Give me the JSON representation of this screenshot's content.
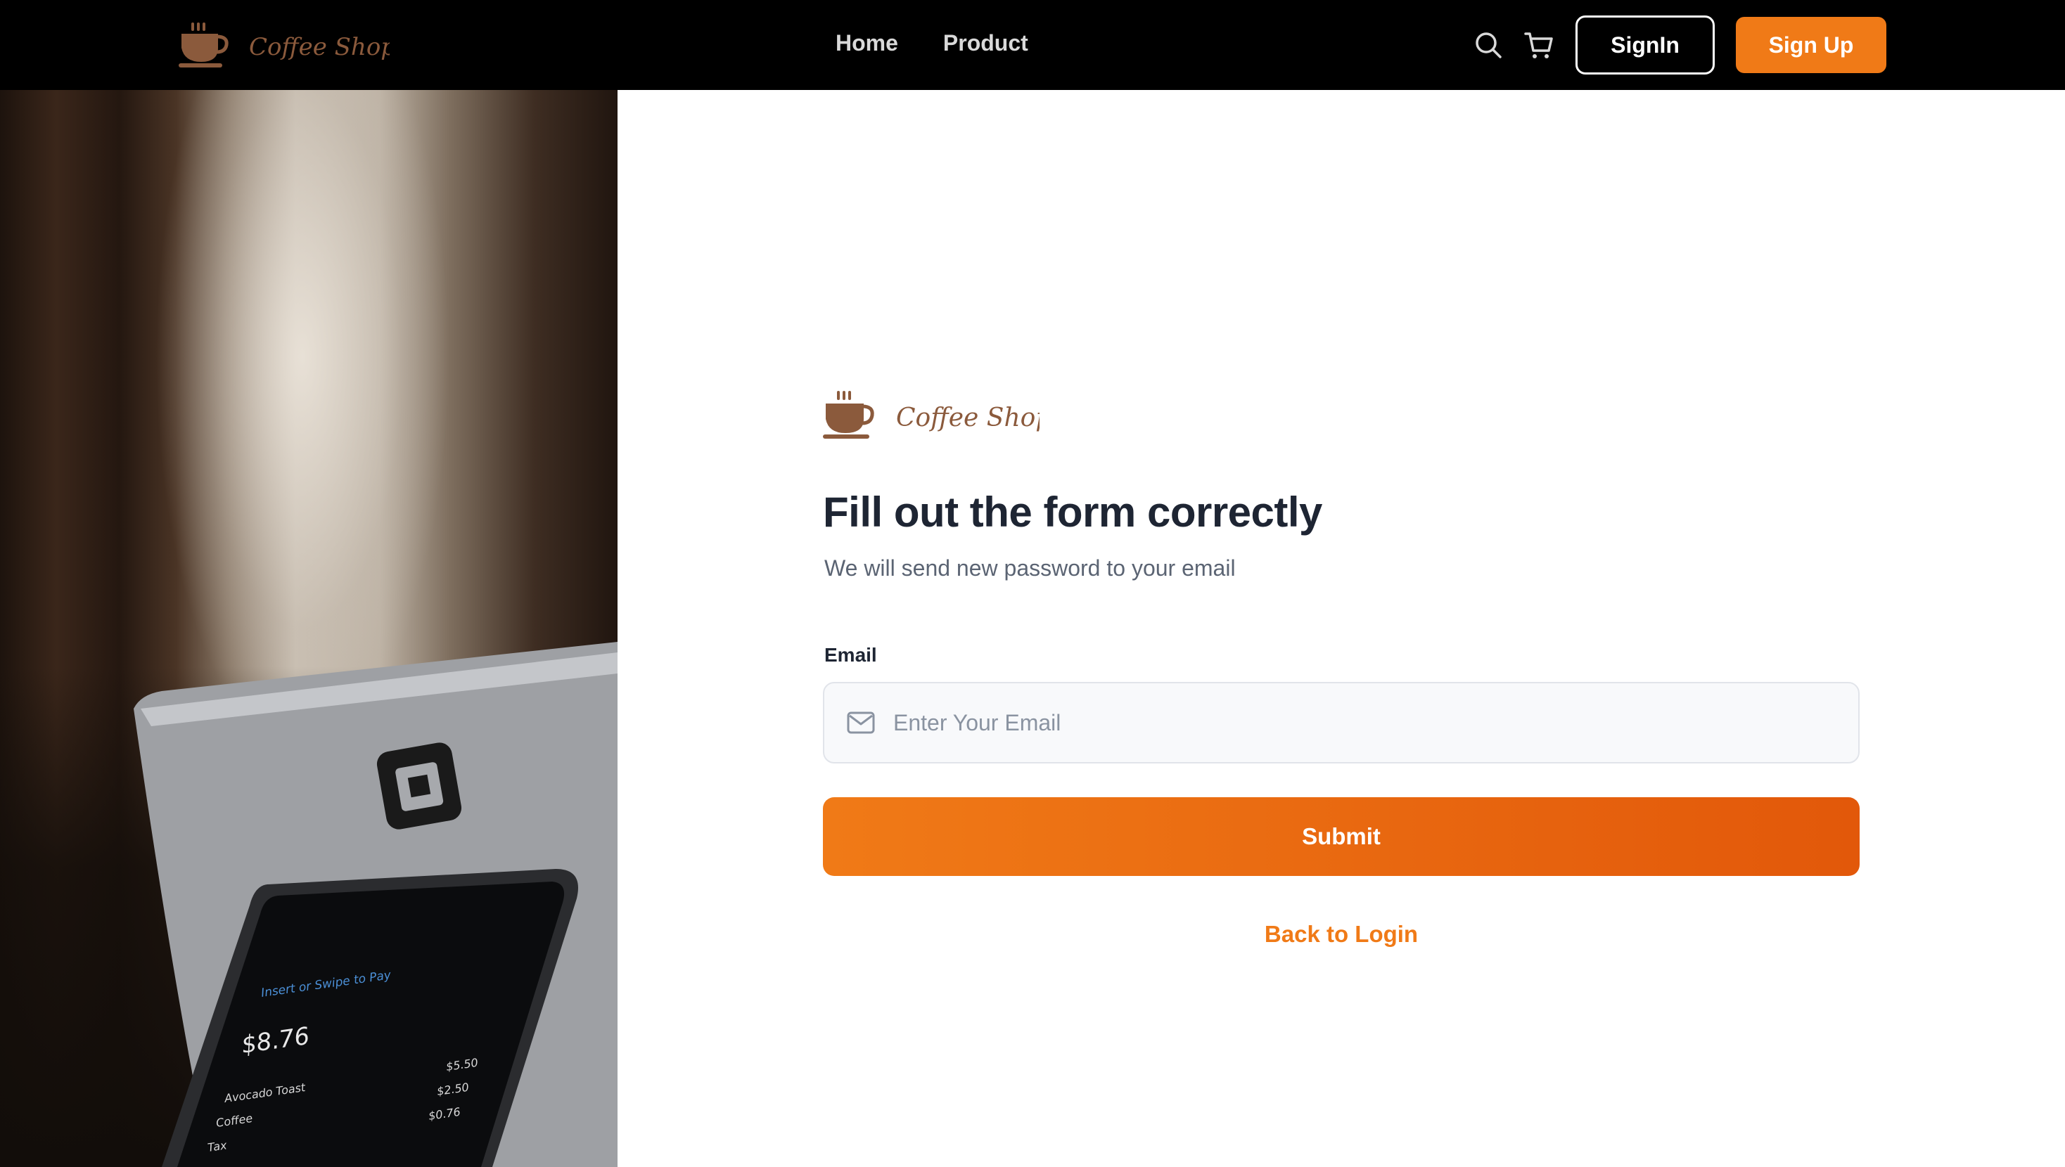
{
  "brand": {
    "name": "Coffee Shop",
    "icon": "coffee-cup-icon",
    "text_color": "#8b5a3c"
  },
  "nav": {
    "links": [
      {
        "label": "Home"
      },
      {
        "label": "Product"
      }
    ],
    "search_icon": "search-icon",
    "cart_icon": "cart-icon",
    "signin_label": "SignIn",
    "signup_label": "Sign Up"
  },
  "photo": {
    "terminal": {
      "prompt": "Insert or Swipe to Pay",
      "total": "$8.76",
      "items": [
        {
          "name": "Avocado Toast",
          "price": "$5.50"
        },
        {
          "name": "Coffee",
          "price": "$2.50"
        },
        {
          "name": "Tax",
          "price": "$0.76"
        }
      ]
    }
  },
  "form": {
    "title": "Fill out the form correctly",
    "subtitle": "We will send new password to your email",
    "email_label": "Email",
    "email_placeholder": "Enter Your Email",
    "email_value": "",
    "submit_label": "Submit",
    "back_label": "Back to Login"
  },
  "colors": {
    "accent": "#f07a17",
    "navbar_bg": "#000000",
    "heading": "#1e2533",
    "muted": "#5b6473"
  }
}
